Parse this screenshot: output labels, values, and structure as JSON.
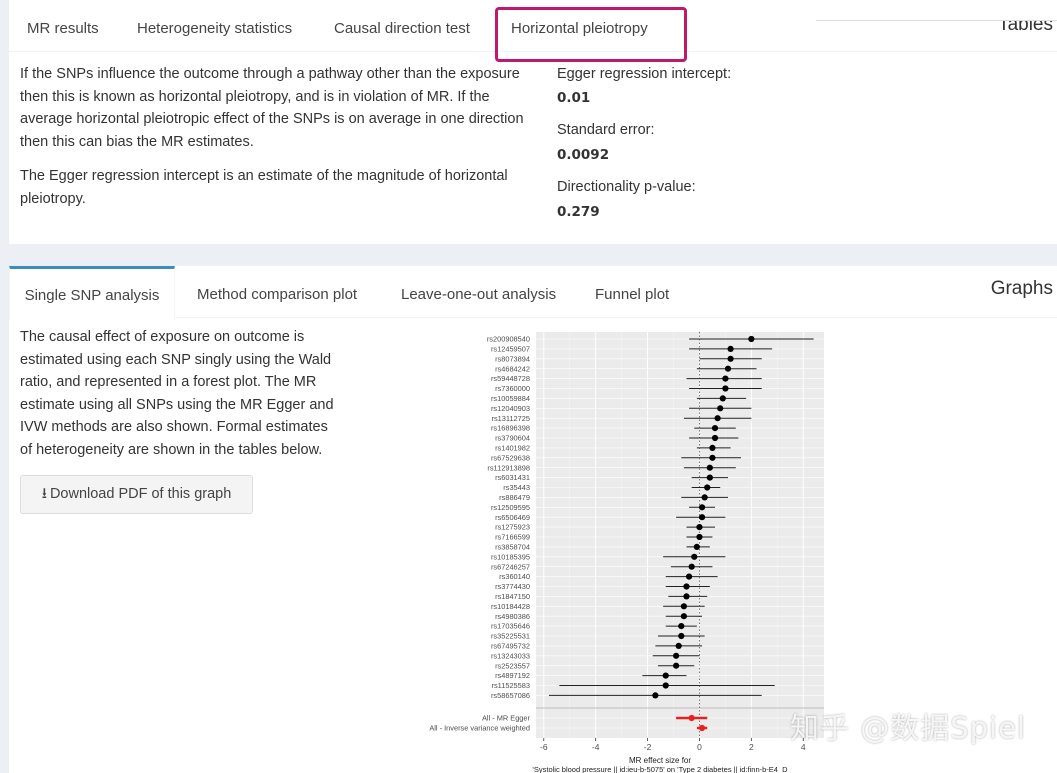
{
  "top_box": {
    "title": "Tables",
    "tabs": [
      "MR results",
      "Heterogeneity statistics",
      "Causal direction test",
      "Horizontal pleiotropy"
    ],
    "active_tab": 3,
    "description_p1": "If the SNPs influence the outcome through a pathway other than the exposure then this is known as horizontal pleiotropy, and is in violation of MR. If the average horizontal pleiotropic effect of the SNPs is on average in one direction then this can bias the MR estimates.",
    "description_p2": "The Egger regression intercept is an estimate of the magnitude of horizontal pleiotropy.",
    "intercept_label": "Egger regression intercept:",
    "intercept_value": "0.01",
    "se_label": "Standard error:",
    "se_value": "0.0092",
    "pval_label": "Directionality p-value:",
    "pval_value": "0.279"
  },
  "graph_box": {
    "title": "Graphs",
    "tabs": [
      "Single SNP analysis",
      "Method comparison plot",
      "Leave-one-out analysis",
      "Funnel plot"
    ],
    "active_tab": 0,
    "description": "The causal effect of exposure on outcome is estimated using each SNP singly using the Wald ratio, and represented in a forest plot. The MR estimate using all SNPs using the MR Egger and IVW methods are also shown. Formal estimates of heterogeneity are shown in the tables below.",
    "download_label": "Download PDF of this graph",
    "download_icon": "download-icon"
  },
  "watermark": "知乎 @数据Spiel",
  "colors": {
    "highlight": "#c2186b",
    "accent": "#3c8dbc",
    "summary": "#e8211f"
  },
  "chart_data": {
    "type": "scatter",
    "title": "",
    "xlabel_line1": "MR effect size for",
    "xlabel_line2": "'Systolic blood pressure || id:ieu-b-5075' on 'Type 2 diabetes || id:finn-b-E4_D",
    "xlim": [
      -6.3,
      4.8
    ],
    "xticks": [
      -6,
      -4,
      -2,
      0,
      2,
      4
    ],
    "reference_line": 0,
    "snps": [
      {
        "label": "rs200908540",
        "est": 2.0,
        "lo": -0.4,
        "hi": 4.4
      },
      {
        "label": "rs12459507",
        "est": 1.2,
        "lo": -0.4,
        "hi": 2.8
      },
      {
        "label": "rs8073894",
        "est": 1.2,
        "lo": 0.0,
        "hi": 2.4
      },
      {
        "label": "rs4684242",
        "est": 1.1,
        "lo": -0.1,
        "hi": 2.2
      },
      {
        "label": "rs59448728",
        "est": 1.0,
        "lo": -0.5,
        "hi": 2.4
      },
      {
        "label": "rs7360000",
        "est": 1.0,
        "lo": -0.4,
        "hi": 2.4
      },
      {
        "label": "rs10059884",
        "est": 0.9,
        "lo": -0.1,
        "hi": 1.8
      },
      {
        "label": "rs12040903",
        "est": 0.8,
        "lo": -0.4,
        "hi": 2.0
      },
      {
        "label": "rs13112725",
        "est": 0.7,
        "lo": -0.6,
        "hi": 2.0
      },
      {
        "label": "rs16896398",
        "est": 0.6,
        "lo": -0.2,
        "hi": 1.4
      },
      {
        "label": "rs3790604",
        "est": 0.6,
        "lo": -0.4,
        "hi": 1.5
      },
      {
        "label": "rs1401982",
        "est": 0.5,
        "lo": -0.1,
        "hi": 1.2
      },
      {
        "label": "rs67529638",
        "est": 0.5,
        "lo": -0.7,
        "hi": 1.6
      },
      {
        "label": "rs112913898",
        "est": 0.4,
        "lo": -0.6,
        "hi": 1.4
      },
      {
        "label": "rs6031431",
        "est": 0.4,
        "lo": -0.3,
        "hi": 1.1
      },
      {
        "label": "rs35443",
        "est": 0.3,
        "lo": -0.3,
        "hi": 0.8
      },
      {
        "label": "rs886479",
        "est": 0.2,
        "lo": -0.7,
        "hi": 1.1
      },
      {
        "label": "rs12509595",
        "est": 0.1,
        "lo": -0.4,
        "hi": 0.6
      },
      {
        "label": "rs6506469",
        "est": 0.1,
        "lo": -0.9,
        "hi": 1.0
      },
      {
        "label": "rs1275923",
        "est": 0.0,
        "lo": -0.5,
        "hi": 0.6
      },
      {
        "label": "rs7166599",
        "est": 0.0,
        "lo": -0.5,
        "hi": 0.5
      },
      {
        "label": "rs3858704",
        "est": -0.1,
        "lo": -0.5,
        "hi": 0.4
      },
      {
        "label": "rs10185395",
        "est": -0.2,
        "lo": -1.4,
        "hi": 1.0
      },
      {
        "label": "rs67246257",
        "est": -0.3,
        "lo": -1.1,
        "hi": 0.5
      },
      {
        "label": "rs360140",
        "est": -0.4,
        "lo": -1.3,
        "hi": 0.7
      },
      {
        "label": "rs3774430",
        "est": -0.5,
        "lo": -1.3,
        "hi": 0.4
      },
      {
        "label": "rs1847150",
        "est": -0.5,
        "lo": -1.2,
        "hi": 0.3
      },
      {
        "label": "rs10184428",
        "est": -0.6,
        "lo": -1.4,
        "hi": 0.2
      },
      {
        "label": "rs4980386",
        "est": -0.6,
        "lo": -1.3,
        "hi": 0.1
      },
      {
        "label": "rs17035646",
        "est": -0.7,
        "lo": -1.3,
        "hi": -0.1
      },
      {
        "label": "rs35225531",
        "est": -0.7,
        "lo": -1.6,
        "hi": 0.2
      },
      {
        "label": "rs67495732",
        "est": -0.8,
        "lo": -1.7,
        "hi": 0.1
      },
      {
        "label": "rs13243033",
        "est": -0.9,
        "lo": -1.8,
        "hi": 0.0
      },
      {
        "label": "rs2523557",
        "est": -0.9,
        "lo": -1.6,
        "hi": -0.2
      },
      {
        "label": "rs4897192",
        "est": -1.3,
        "lo": -2.2,
        "hi": -0.5
      },
      {
        "label": "rs11525583",
        "est": -1.3,
        "lo": -5.4,
        "hi": 2.9
      },
      {
        "label": "rs58657086",
        "est": -1.7,
        "lo": -5.8,
        "hi": 2.4
      }
    ],
    "summary": [
      {
        "label": "All - MR Egger",
        "est": -0.3,
        "lo": -0.9,
        "hi": 0.3
      },
      {
        "label": "All - Inverse variance weighted",
        "est": 0.1,
        "lo": -0.1,
        "hi": 0.3
      }
    ]
  }
}
